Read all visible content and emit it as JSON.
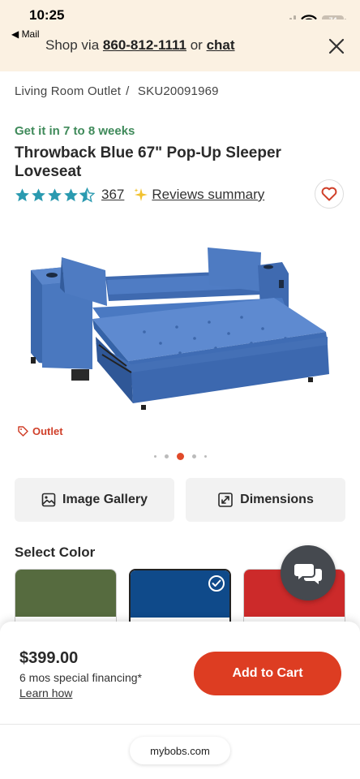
{
  "status_bar": {
    "time": "10:25",
    "back_label": "◀ Mail",
    "battery": "74"
  },
  "banner": {
    "prefix": "Shop via",
    "phone": "860-812-1111",
    "middle": "or",
    "chat_label": "chat"
  },
  "breadcrumb": {
    "category": "Living Room Outlet",
    "separator": "/",
    "sku": "SKU20091969"
  },
  "product": {
    "delivery": "Get it in 7 to 8 weeks",
    "title": "Throwback Blue 67\" Pop-Up Sleeper Loveseat",
    "rating": 4.5,
    "review_count": "367",
    "reviews_summary_label": "Reviews summary",
    "outlet_label": "Outlet",
    "image_index": 3,
    "image_total": 5
  },
  "actions": {
    "gallery_label": "Image Gallery",
    "dimensions_label": "Dimensions"
  },
  "colors": {
    "heading": "Select Color",
    "swatches": [
      {
        "hex": "#566b3f",
        "selected": false
      },
      {
        "hex": "#0f4a8a",
        "selected": true
      },
      {
        "hex": "#cc2a2a",
        "selected": false
      }
    ]
  },
  "purchase": {
    "price": "$399.00",
    "financing": "6 mos special financing*",
    "learn_how": "Learn how",
    "add_to_cart": "Add to Cart"
  },
  "browser": {
    "url": "mybobs.com"
  },
  "theme": {
    "accent": "#dd3d22",
    "green": "#3f8a5a",
    "star": "#2a9ab0",
    "banner_bg": "#fbf1e2"
  }
}
